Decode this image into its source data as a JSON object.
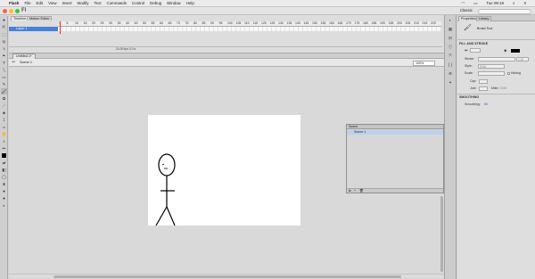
{
  "menubar": {
    "app_name": "Flash",
    "items": [
      "File",
      "Edit",
      "View",
      "Insert",
      "Modify",
      "Text",
      "Commands",
      "Control",
      "Debug",
      "Window",
      "Help"
    ],
    "clock": "Tue 09:18"
  },
  "appbar": {
    "logo": "Fl",
    "workspace": "Classic"
  },
  "timeline": {
    "tabs": [
      "Timeline",
      "Motion Editor"
    ],
    "frame_numbers": [
      "1",
      "5",
      "10",
      "15",
      "20",
      "25",
      "30",
      "35",
      "40",
      "45",
      "50",
      "55",
      "60",
      "65",
      "70",
      "75",
      "80",
      "85",
      "90",
      "95",
      "100",
      "105",
      "110",
      "115",
      "120",
      "125",
      "130",
      "135",
      "140",
      "145",
      "150",
      "155",
      "160",
      "165",
      "170",
      "175",
      "180",
      "185",
      "190",
      "195",
      "200",
      "205",
      "210",
      "215",
      "220"
    ],
    "layer_name": "Layer 1",
    "status": "24.00 fps   0.0 s"
  },
  "document": {
    "tab": "Untitled-1*",
    "scene": "Scene 1",
    "zoom": "100%"
  },
  "scene_panel": {
    "title": "Scene",
    "item": "Scene 1"
  },
  "properties": {
    "tabs": [
      "Properties",
      "Library"
    ],
    "tool_name": "Brush Tool",
    "section_fill_stroke": "FILL AND STROKE",
    "stroke_label": "Stroke:",
    "stroke_value": "1.00",
    "style_label": "Style:",
    "style_value": "Solid",
    "scale_label": "Scale:",
    "hinting_label": "Hinting",
    "cap_label": "Cap:",
    "join_label": "Join:",
    "miter_label": "Miter:",
    "miter_value": "3.00",
    "section_smoothing": "SMOOTHING",
    "smoothing_label": "Smoothing:",
    "smoothing_value": "50"
  },
  "colors": {
    "close": "#fc5f57",
    "minimize": "#fdbc2e",
    "zoom": "#33c748",
    "layer_selected": "#4a7fd8",
    "playhead": "#e03333"
  }
}
